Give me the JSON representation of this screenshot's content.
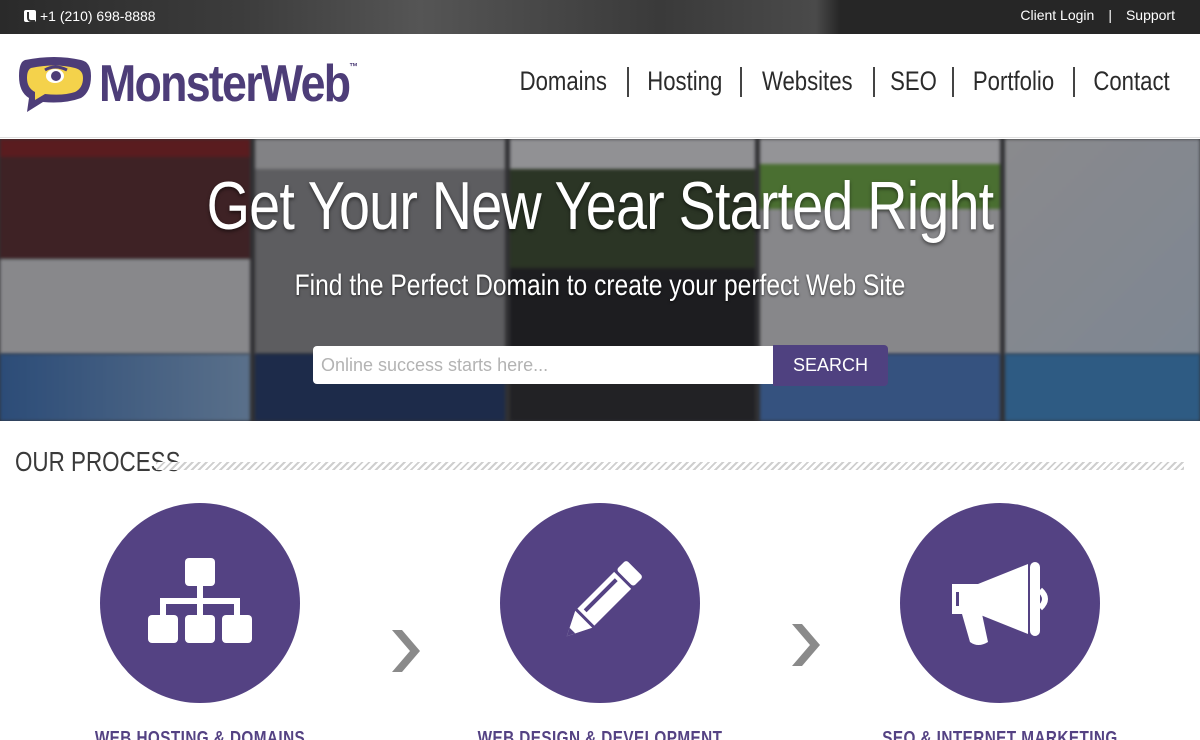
{
  "topbar": {
    "phone": "+1 (210) 698-8888",
    "client_login": "Client Login",
    "divider": "|",
    "support": "Support"
  },
  "brand": {
    "name": "MonsterWeb",
    "trademark": "™",
    "color": "#4d3d78",
    "accent": "#f4d24b"
  },
  "nav": {
    "items": [
      "Domains",
      "Hosting",
      "Websites",
      "SEO",
      "Portfolio",
      "Contact"
    ]
  },
  "hero": {
    "title": "Get Your New Year Started Right",
    "subtitle": "Find the Perfect Domain to create your perfect Web Site",
    "search_placeholder": "Online success starts here...",
    "search_button": "SEARCH"
  },
  "process": {
    "title": "OUR PROCESS",
    "steps": [
      {
        "label": "WEB HOSTING & DOMAINS",
        "icon": "sitemap-icon"
      },
      {
        "label": "WEB DESIGN & DEVELOPMENT",
        "icon": "pencil-icon"
      },
      {
        "label": "SEO & INTERNET MARKETING",
        "icon": "megaphone-icon"
      }
    ],
    "circle_color": "#544283",
    "arrow_color": "#8a8a8a"
  }
}
